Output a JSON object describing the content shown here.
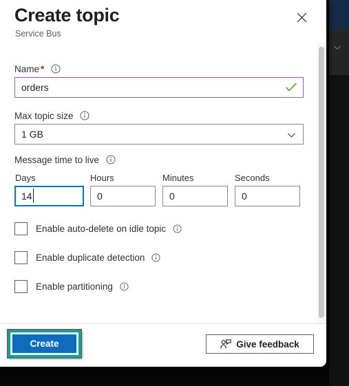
{
  "panel": {
    "title": "Create topic",
    "subtitle": "Service Bus",
    "close_icon": "close-icon"
  },
  "form": {
    "name": {
      "label": "Name",
      "required_marker": "*",
      "value": "orders",
      "valid_icon": "checkmark-icon",
      "info_icon": "info-icon"
    },
    "max_topic_size": {
      "label": "Max topic size",
      "value": "1 GB",
      "chevron_icon": "chevron-down-icon",
      "info_icon": "info-icon"
    },
    "message_ttl": {
      "label": "Message time to live",
      "info_icon": "info-icon",
      "fields": [
        {
          "label": "Days",
          "value": "14"
        },
        {
          "label": "Hours",
          "value": "0"
        },
        {
          "label": "Minutes",
          "value": "0"
        },
        {
          "label": "Seconds",
          "value": "0"
        }
      ]
    },
    "checkboxes": [
      {
        "label": "Enable auto-delete on idle topic",
        "checked": false
      },
      {
        "label": "Enable duplicate detection",
        "checked": false
      },
      {
        "label": "Enable partitioning",
        "checked": false
      }
    ]
  },
  "footer": {
    "create_label": "Create",
    "feedback_label": "Give feedback",
    "feedback_icon": "person-feedback-icon"
  },
  "colors": {
    "accent_blue": "#0f6cbd",
    "highlight_teal": "#12a094",
    "focus_blue": "#0078d4",
    "valid_purple": "#8764b8",
    "valid_green": "#6aaa30",
    "required_red": "#a4262c"
  }
}
